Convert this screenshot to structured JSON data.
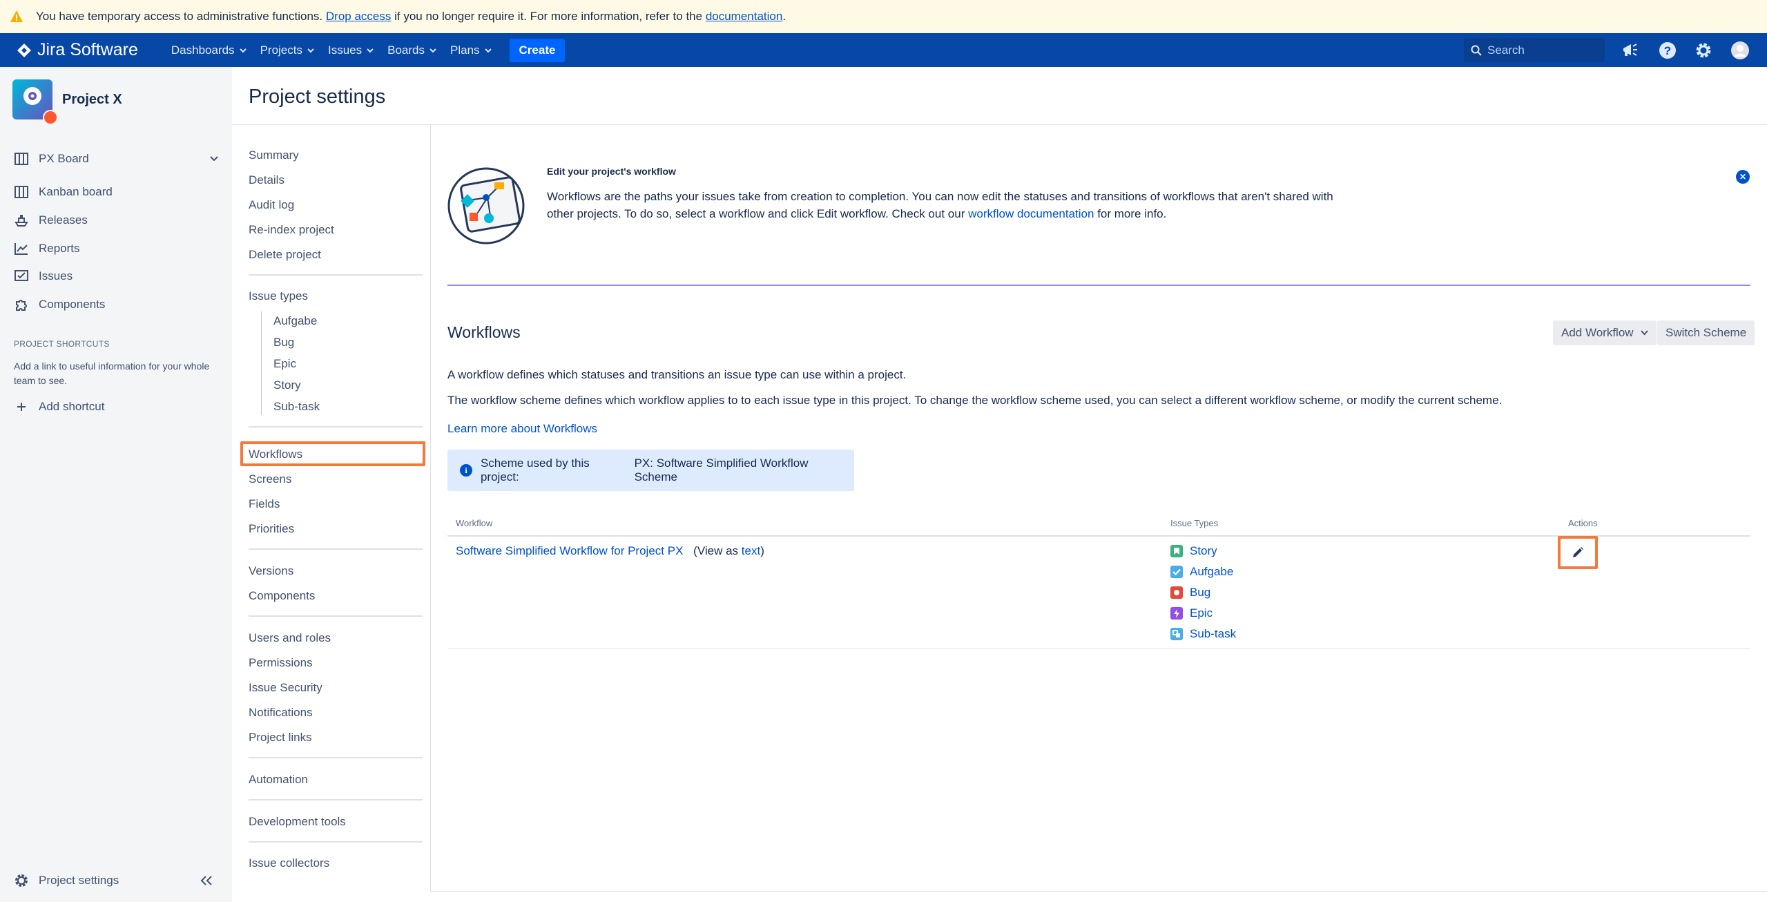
{
  "banner": {
    "pre": "You have temporary access to administrative functions.",
    "drop_link": "Drop access",
    "mid": "if you no longer require it. For more information, refer to the",
    "doc_link": "documentation",
    "end": "."
  },
  "topnav": {
    "logo": "Jira Software",
    "items": [
      "Dashboards",
      "Projects",
      "Issues",
      "Boards",
      "Plans"
    ],
    "create": "Create",
    "search_placeholder": "Search"
  },
  "sidebar": {
    "project_name": "Project X",
    "board": "PX Board",
    "items": [
      "Kanban board",
      "Releases",
      "Reports",
      "Issues",
      "Components"
    ],
    "shortcuts_heading": "PROJECT SHORTCUTS",
    "shortcuts_note": "Add a link to useful information for your whole team to see.",
    "add_shortcut": "Add shortcut",
    "footer": "Project settings"
  },
  "settings": {
    "title": "Project settings",
    "group1": [
      "Summary",
      "Details",
      "Audit log",
      "Re-index project",
      "Delete project"
    ],
    "issue_types_label": "Issue types",
    "issue_types": [
      "Aufgabe",
      "Bug",
      "Epic",
      "Story",
      "Sub-task"
    ],
    "group3": [
      "Workflows",
      "Screens",
      "Fields",
      "Priorities"
    ],
    "group4": [
      "Versions",
      "Components"
    ],
    "group5": [
      "Users and roles",
      "Permissions",
      "Issue Security",
      "Notifications",
      "Project links"
    ],
    "group6": [
      "Automation"
    ],
    "group7": [
      "Development tools"
    ],
    "group8": [
      "Issue collectors"
    ]
  },
  "info": {
    "title": "Edit your project's workflow",
    "desc_pre": "Workflows are the paths your issues take from creation to completion. You can now edit the statuses and transitions of workflows that aren't shared with other projects. To do so, select a workflow and click Edit workflow. Check out our",
    "desc_link": "workflow documentation",
    "desc_post": "for more info."
  },
  "workflows": {
    "title": "Workflows",
    "add_button": "Add Workflow",
    "switch_button": "Switch Scheme",
    "para1": "A workflow defines which statuses and transitions an issue type can use within a project.",
    "para2": "The workflow scheme defines which workflow applies to to each issue type in this project. To change the workflow scheme used, you can select a different workflow scheme, or modify the current scheme.",
    "learn_more": "Learn more about Workflows",
    "scheme_label": "Scheme used by this project:",
    "scheme_name": "PX: Software Simplified Workflow Scheme",
    "col_workflow": "Workflow",
    "col_issue_types": "Issue Types",
    "col_actions": "Actions",
    "row_name": "Software Simplified Workflow for Project PX",
    "row_view_pre": "(View as",
    "row_view_link": "text",
    "row_view_post": ")",
    "row_types": [
      "Story",
      "Aufgabe",
      "Bug",
      "Epic",
      "Sub-task"
    ]
  },
  "colors": {
    "nav": "#0747A6",
    "accent": "#0052CC",
    "highlight": "#F5793A",
    "story": "#36B37E",
    "task": "#4BADE8",
    "bug": "#E5493A",
    "epic": "#904EE2",
    "subtask": "#4BADE8"
  }
}
